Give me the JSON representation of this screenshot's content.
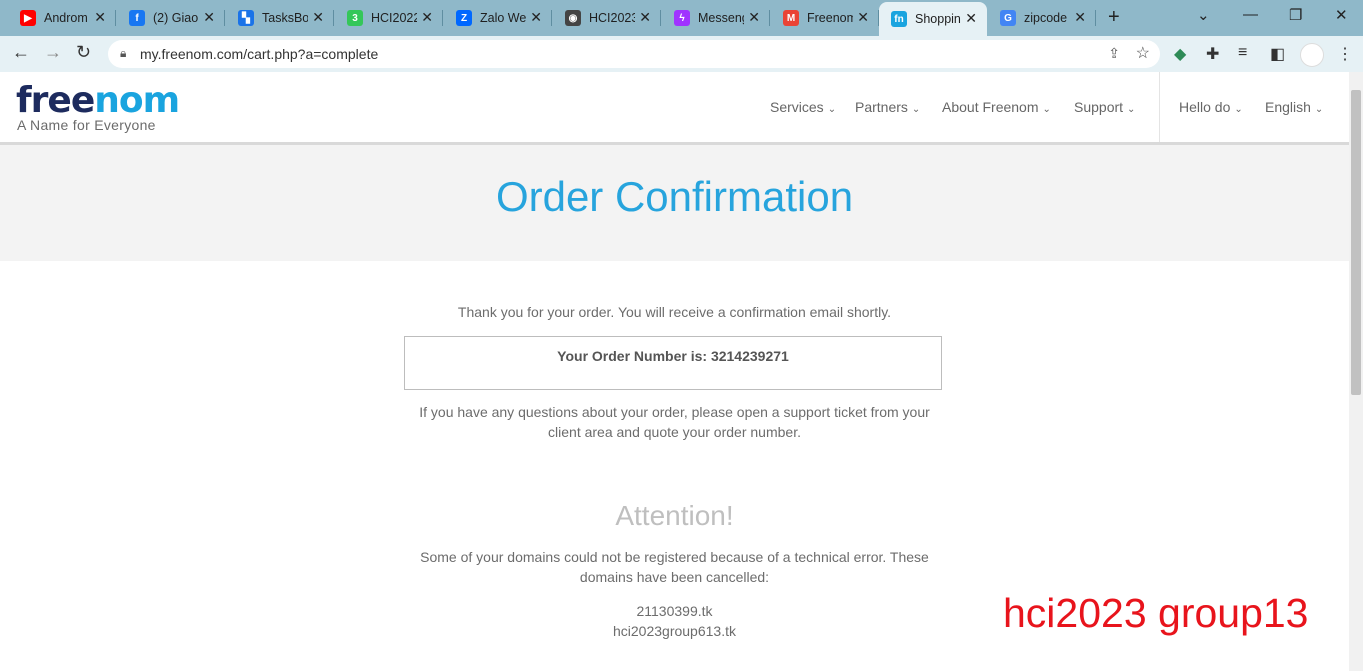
{
  "browser": {
    "tabs": [
      {
        "title": "Androm",
        "icon": "youtube-icon",
        "color": "#ff0000",
        "glyph": "▶"
      },
      {
        "title": "(2) Giao",
        "icon": "facebook-icon",
        "color": "#1877f2",
        "glyph": "f"
      },
      {
        "title": "TasksBo",
        "icon": "tasksboard-icon",
        "color": "#1a73e8",
        "glyph": "▚"
      },
      {
        "title": "HCI2022",
        "icon": "green-3-icon",
        "color": "#34c759",
        "glyph": "3"
      },
      {
        "title": "Zalo We",
        "icon": "zalo-icon",
        "color": "#0068ff",
        "glyph": "Z"
      },
      {
        "title": "HCI2023",
        "icon": "globe-icon",
        "color": "#444444",
        "glyph": "◉"
      },
      {
        "title": "Messeng",
        "icon": "messenger-icon",
        "color": "#a033ff",
        "glyph": "ϟ"
      },
      {
        "title": "Freenom",
        "icon": "gmail-icon",
        "color": "#ea4335",
        "glyph": "M"
      },
      {
        "title": "Shoppin",
        "icon": "freenom-icon",
        "color": "#1aa4df",
        "glyph": "fn",
        "active": true
      },
      {
        "title": "zipcode",
        "icon": "google-icon",
        "color": "#4285f4",
        "glyph": "G"
      }
    ],
    "url": "my.freenom.com/cart.php?a=complete"
  },
  "site": {
    "logo_dark": "free",
    "logo_blue": "nom",
    "tagline": "A Name for Everyone",
    "menu": [
      "Services",
      "Partners",
      "About Freenom",
      "Support"
    ],
    "user": "Hello do",
    "language": "English"
  },
  "page": {
    "title": "Order Confirmation",
    "thanks": "Thank you for your order. You will receive a confirmation email shortly.",
    "order_number": "Your Order Number is: 3214239271",
    "support_line1": "If you have any questions about your order, please open a support ticket from your",
    "support_line2": "client area and quote your order number.",
    "attention_title": "Attention!",
    "attention_line1": "Some of your domains could not be registered because of a technical error. These",
    "attention_line2": "domains have been cancelled:",
    "domains": [
      "21130399.tk",
      "hci2023group613.tk"
    ]
  },
  "watermark": "hci2023 group13"
}
